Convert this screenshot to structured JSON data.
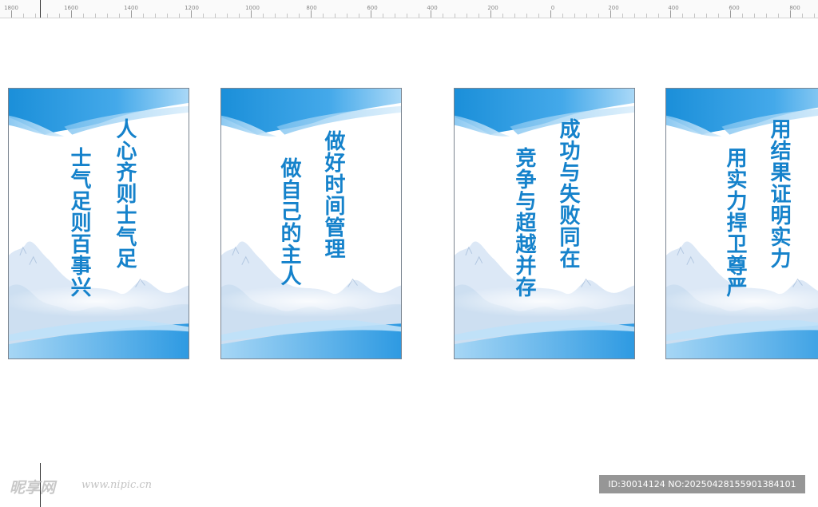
{
  "ruler": {
    "labels": [
      "1800",
      "1600",
      "1400",
      "1200",
      "1000",
      "800",
      "600",
      "400",
      "200",
      "0",
      "200",
      "400",
      "600",
      "800"
    ]
  },
  "panels": [
    {
      "columns": [
        "人心齐则士气足",
        "士气足则百事兴"
      ]
    },
    {
      "columns": [
        "做好时间管理",
        "做自己的主人"
      ]
    },
    {
      "columns": [
        "成功与失败同在",
        "竞争与超越并存"
      ]
    },
    {
      "columns": [
        "用结果证明实力",
        "用实力捍卫尊严"
      ]
    }
  ],
  "watermark": {
    "logo": "昵享网",
    "url": "www.nipic.cn",
    "id_text": "ID:30014124 NO:20250428155901384101"
  },
  "colors": {
    "text_blue": "#1582cb",
    "banner_dark": "#1b8fd9",
    "banner_light": "#8ccaf3"
  }
}
